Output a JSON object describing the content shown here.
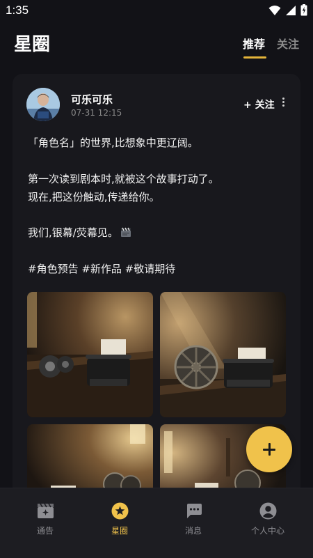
{
  "status_bar": {
    "time": "1:35"
  },
  "header": {
    "title": "星圈",
    "tabs": [
      {
        "label": "推荐",
        "active": true
      },
      {
        "label": "关注",
        "active": false
      }
    ]
  },
  "post": {
    "username": "可乐可乐",
    "time": "07-31 12:15",
    "follow_label": "+ 关注",
    "content": [
      "「角色名」的世界,比想象中更辽阔。",
      "第一次读到剧本时,就被这个故事打动了。",
      "现在,把这份触动,传递给你。",
      "我们,银幕/荧幕见。",
      "#角色预告 #新作品 #敬请期待"
    ],
    "emoji_icon": "clapperboard-icon",
    "images": [
      {
        "name": "typewriter-photo-1"
      },
      {
        "name": "typewriter-photo-2"
      },
      {
        "name": "typewriter-photo-3"
      },
      {
        "name": "typewriter-photo-4"
      }
    ]
  },
  "fab": {
    "icon": "plus-icon"
  },
  "bottom_nav": [
    {
      "label": "通告",
      "icon": "clapperboard-sparkle-icon",
      "active": false
    },
    {
      "label": "星圈",
      "icon": "star-circle-icon",
      "active": true
    },
    {
      "label": "消息",
      "icon": "chat-bubble-icon",
      "active": false
    },
    {
      "label": "个人中心",
      "icon": "person-icon",
      "active": false
    }
  ],
  "colors": {
    "accent": "#f0c24b",
    "background": "#121217",
    "card": "#18181d"
  }
}
